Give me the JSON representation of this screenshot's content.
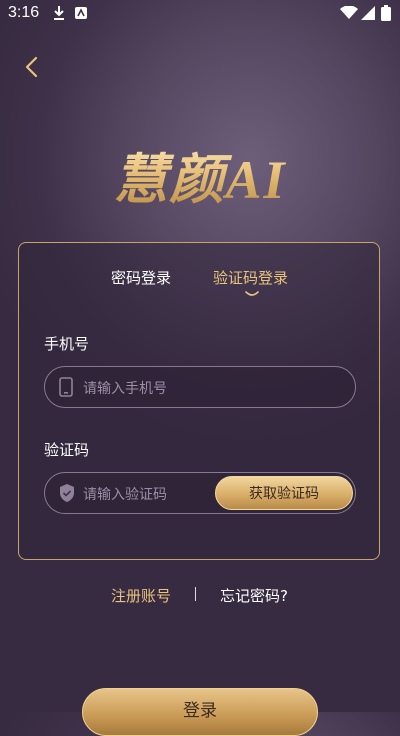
{
  "status_bar": {
    "time": "3:16"
  },
  "logo_text": "慧颜AI",
  "tabs": [
    {
      "label": "密码登录",
      "active": false
    },
    {
      "label": "验证码登录",
      "active": true
    }
  ],
  "form": {
    "phone_label": "手机号",
    "phone_placeholder": "请输入手机号",
    "code_label": "验证码",
    "code_placeholder": "请输入验证码",
    "get_code_button": "获取验证码"
  },
  "links": {
    "register": "注册账号",
    "forgot_password": "忘记密码?"
  },
  "login_button": "登录",
  "colors": {
    "accent_gold": "#e9c27b",
    "background": "#4a3c55"
  }
}
